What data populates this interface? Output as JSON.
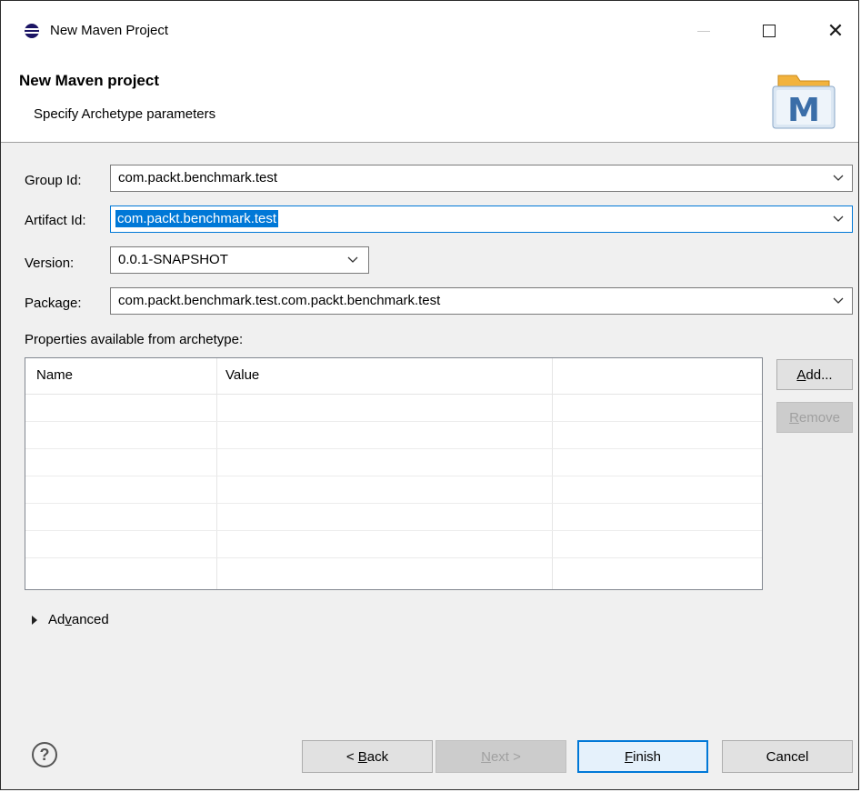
{
  "window": {
    "title": "New Maven Project"
  },
  "banner": {
    "title": "New Maven project",
    "subtitle": "Specify Archetype parameters",
    "logo_letter": "M"
  },
  "form": {
    "group_id": {
      "label": "Group Id:",
      "value": "com.packt.benchmark.test"
    },
    "artifact_id": {
      "label": "Artifact Id:",
      "value": "com.packt.benchmark.test"
    },
    "version": {
      "label": "Version:",
      "value": "0.0.1-SNAPSHOT"
    },
    "package": {
      "label": "Package:",
      "value": "com.packt.benchmark.test.com.packt.benchmark.test"
    }
  },
  "properties": {
    "label": "Properties available from archetype:",
    "columns": [
      "Name",
      "Value"
    ],
    "rows": [],
    "add_button": {
      "pre": "",
      "mnemonic": "A",
      "post": "dd..."
    },
    "remove_button": {
      "pre": "",
      "mnemonic": "R",
      "post": "emove"
    }
  },
  "advanced": {
    "pre": "Ad",
    "mnemonic": "v",
    "post": "anced"
  },
  "footer": {
    "help_glyph": "?",
    "back": {
      "pre": "< ",
      "mnemonic": "B",
      "post": "ack"
    },
    "next": {
      "pre": "",
      "mnemonic": "N",
      "post": "ext >"
    },
    "finish": {
      "pre": "",
      "mnemonic": "F",
      "post": "inish"
    },
    "cancel": "Cancel"
  },
  "colors": {
    "accent": "#0078d7",
    "selection": "#0078d7",
    "logo_blue": "#3b6ea8",
    "logo_folder": "#f2b33d"
  }
}
